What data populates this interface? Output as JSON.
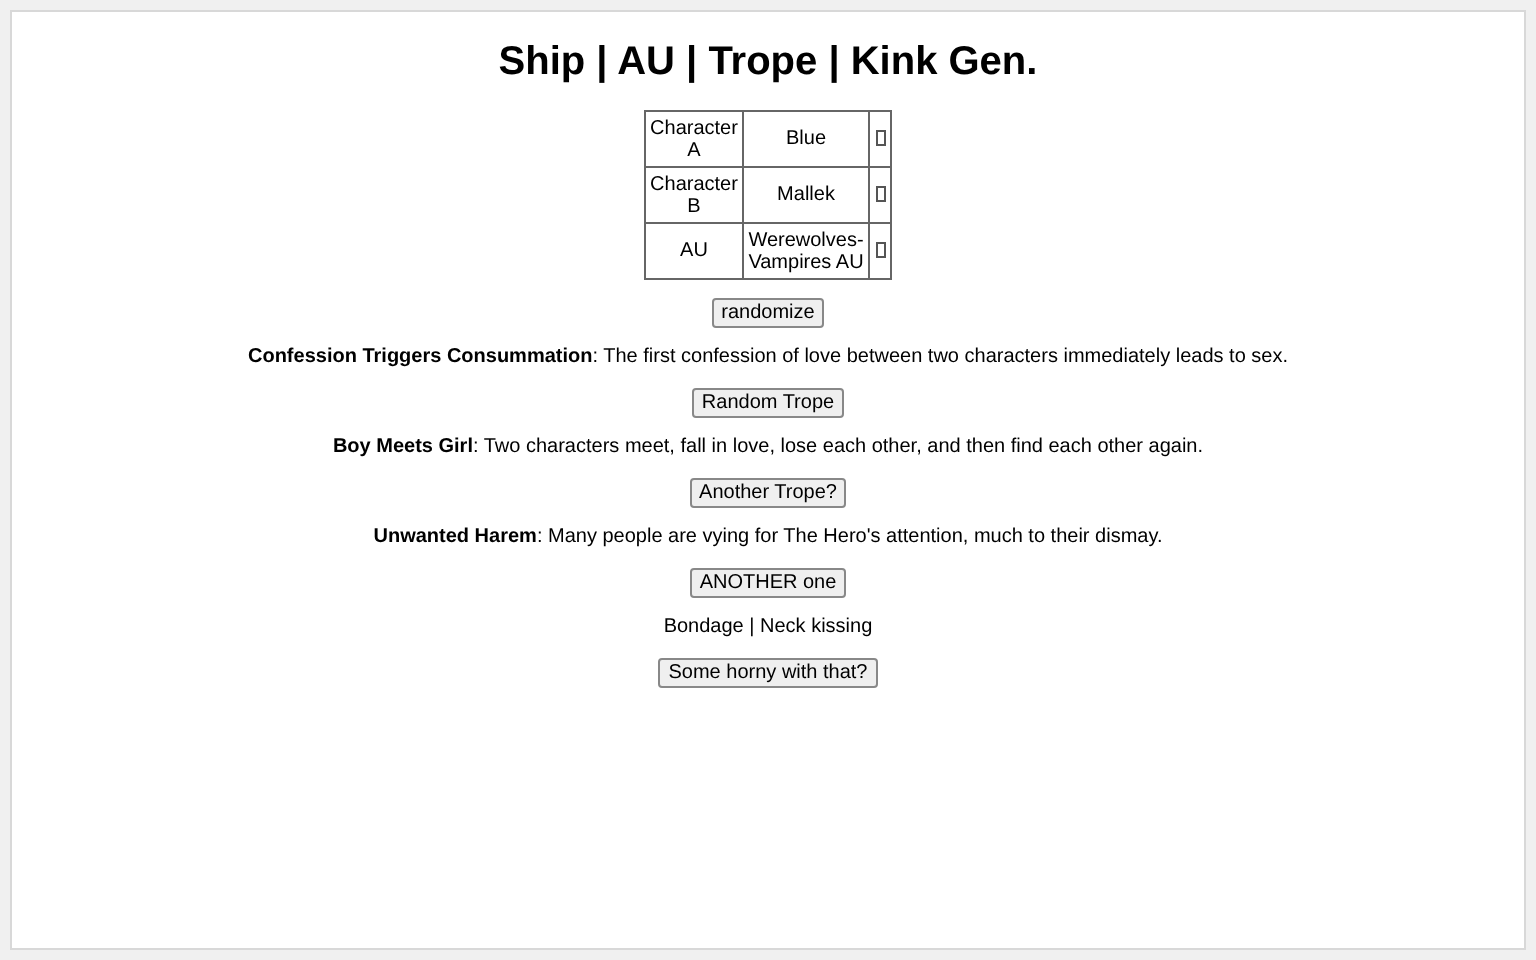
{
  "title": "Ship | AU | Trope | Kink Gen.",
  "table": {
    "rows": [
      {
        "label": "Character A",
        "value": "Blue"
      },
      {
        "label": "Character B",
        "value": "Mallek"
      },
      {
        "label": "AU",
        "value": "Werewolves-Vampires AU"
      }
    ]
  },
  "items": [
    {
      "kind": "button",
      "label": "randomize"
    },
    {
      "kind": "trope",
      "name": "Confession Triggers Consummation",
      "text": ": The first confession of love between two characters immediately leads to sex."
    },
    {
      "kind": "button",
      "label": "Random Trope"
    },
    {
      "kind": "trope",
      "name": "Boy Meets Girl",
      "text": ": Two characters meet, fall in love, lose each other, and then find each other again."
    },
    {
      "kind": "button",
      "label": "Another Trope?"
    },
    {
      "kind": "trope",
      "name": "Unwanted Harem",
      "text": ": Many people are vying for The Hero's attention, much to their dismay."
    },
    {
      "kind": "button",
      "label": "ANOTHER one"
    },
    {
      "kind": "text",
      "text": "Bondage | Neck kissing"
    },
    {
      "kind": "button",
      "label": "Some horny with that?"
    }
  ]
}
